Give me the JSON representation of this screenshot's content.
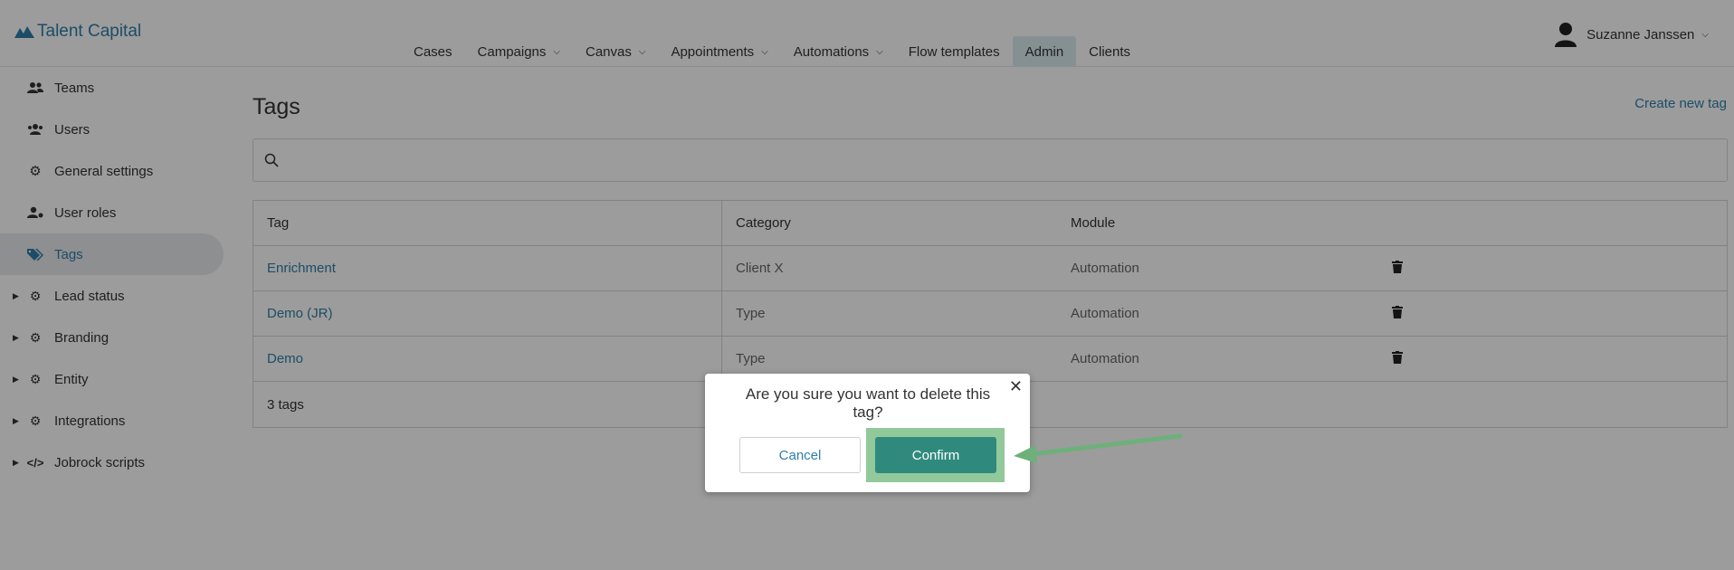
{
  "app": {
    "logo_text": "Talent Capital"
  },
  "nav": {
    "items": [
      {
        "label": "Cases",
        "dropdown": false
      },
      {
        "label": "Campaigns",
        "dropdown": true
      },
      {
        "label": "Canvas",
        "dropdown": true
      },
      {
        "label": "Appointments",
        "dropdown": true
      },
      {
        "label": "Automations",
        "dropdown": true
      },
      {
        "label": "Flow templates",
        "dropdown": false
      },
      {
        "label": "Admin",
        "dropdown": false,
        "active": true
      },
      {
        "label": "Clients",
        "dropdown": false
      }
    ]
  },
  "user": {
    "name": "Suzanne Janssen"
  },
  "sidebar": {
    "items": [
      {
        "label": "Teams",
        "icon": "users-icon"
      },
      {
        "label": "Users",
        "icon": "user-group-icon"
      },
      {
        "label": "General settings",
        "icon": "gear-icon"
      },
      {
        "label": "User roles",
        "icon": "user-gear-icon"
      },
      {
        "label": "Tags",
        "icon": "tags-icon",
        "active": true
      },
      {
        "label": "Lead status",
        "icon": "gears-icon",
        "expandable": true
      },
      {
        "label": "Branding",
        "icon": "gears-icon",
        "expandable": true
      },
      {
        "label": "Entity",
        "icon": "gears-icon",
        "expandable": true
      },
      {
        "label": "Integrations",
        "icon": "gears-icon",
        "expandable": true
      },
      {
        "label": "Jobrock scripts",
        "icon": "code-icon",
        "expandable": true
      }
    ]
  },
  "main": {
    "title": "Tags",
    "create_link": "Create new tag",
    "search_placeholder": "",
    "table": {
      "headers": [
        "Tag",
        "Category",
        "Module"
      ],
      "rows": [
        {
          "tag": "Enrichment",
          "category": "Client X",
          "module": "Automation"
        },
        {
          "tag": "Demo (JR)",
          "category": "Type",
          "module": "Automation"
        },
        {
          "tag": "Demo",
          "category": "Type",
          "module": "Automation"
        }
      ],
      "footer": "3 tags"
    }
  },
  "modal": {
    "message": "Are you sure you want to delete this tag?",
    "cancel_label": "Cancel",
    "confirm_label": "Confirm"
  },
  "colors": {
    "accent": "#2e7fa8",
    "confirm": "#2f8a7d",
    "highlight": "#92c99a",
    "arrow": "#6db07a"
  }
}
